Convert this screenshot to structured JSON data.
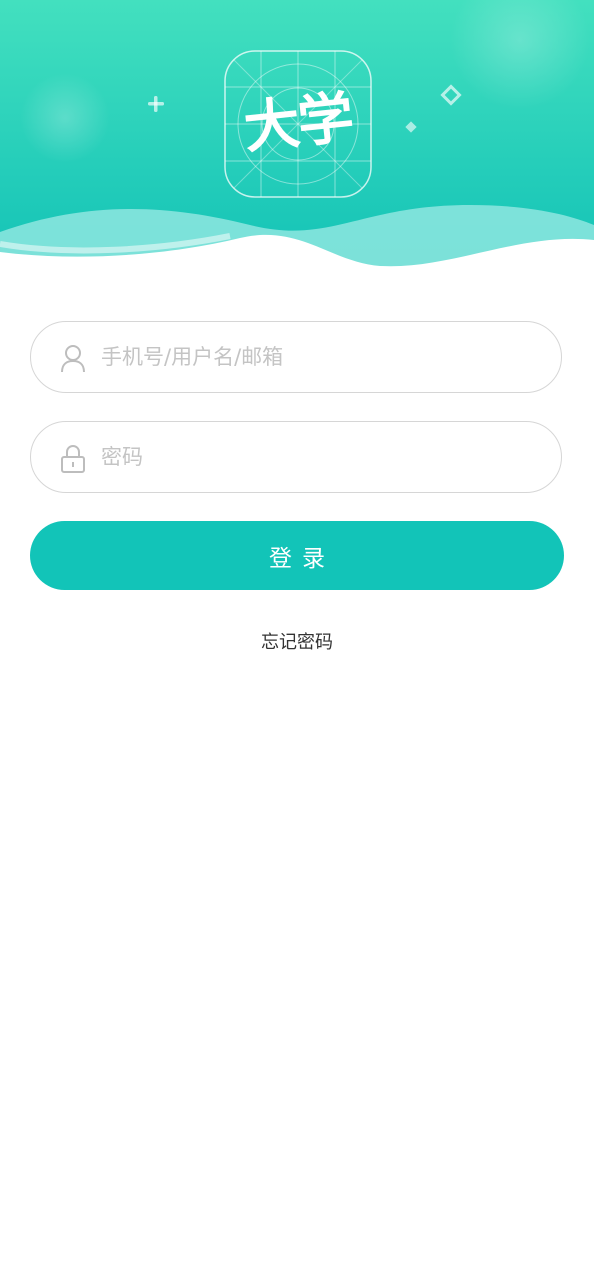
{
  "brand": {
    "logo_text": "大学",
    "accent_color": "#12c4b8",
    "header_gradient_top": "#40dfbd",
    "header_gradient_bottom": "#11c2b5"
  },
  "form": {
    "username": {
      "placeholder": "手机号/用户名/邮箱",
      "value": "",
      "icon": "user-icon"
    },
    "password": {
      "placeholder": "密码",
      "value": "",
      "icon": "lock-icon"
    },
    "login_label": "登录",
    "forgot_label": "忘记密码"
  }
}
